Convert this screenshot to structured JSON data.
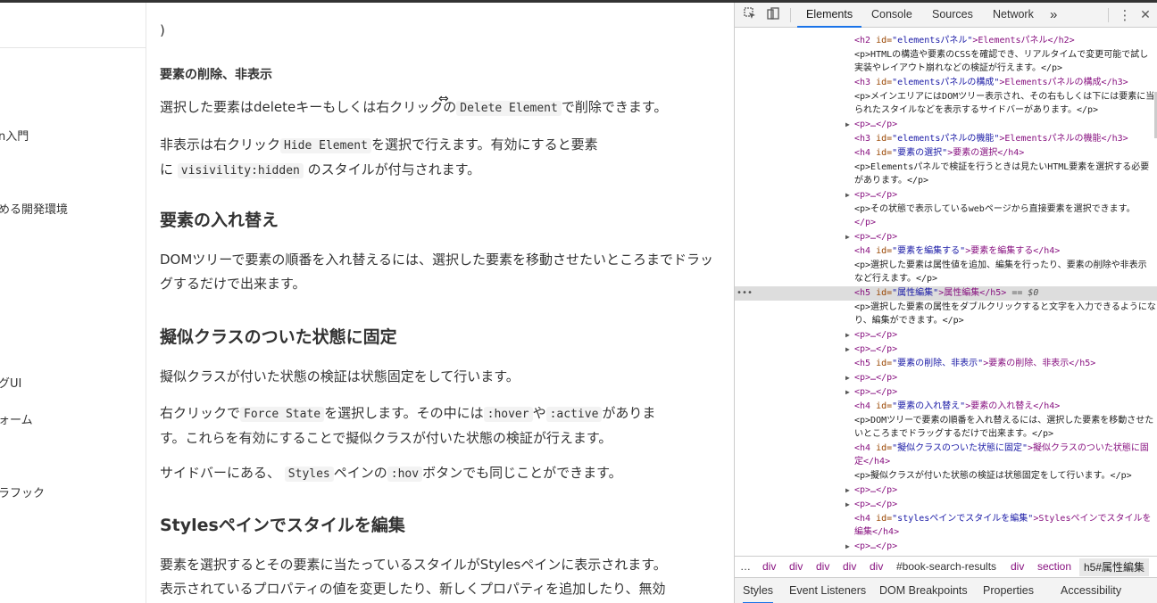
{
  "left_nav": {
    "items": [
      "n入門",
      "める開発環境",
      "グUI",
      "ォーム",
      "ラフック"
    ]
  },
  "article": {
    "paren": ")",
    "h_delete": "要素の削除、非表示",
    "p_delete_1a": "選択した要素はdeleteキーもしくは右クリックの",
    "code_delete": "Delete Element",
    "p_delete_1b": "で削除できます。",
    "p_hide_a": "非表示は右クリック",
    "code_hide": "Hide Element",
    "p_hide_b": "を選択で行えます。有効にすると要素",
    "p_hide_c": "に",
    "code_visibility": "visivility:hidden",
    "p_hide_d": "のスタイルが付与されます。",
    "h_swap": "要素の入れ替え",
    "p_swap": "DOMツリーで要素の順番を入れ替えるには、選択した要素を移動させたいところまでドラッグするだけで出来ます。",
    "h_pseudo": "擬似クラスのついた状態に固定",
    "p_pseudo_1": "擬似クラスが付いた状態の検証は状態固定をして行います。",
    "p_pseudo_2a": "右クリックで",
    "code_force": "Force State",
    "p_pseudo_2b": "を選択します。その中には",
    "code_hover": ":hover",
    "p_pseudo_2c": "や",
    "code_active": ":active",
    "p_pseudo_2d": "がありま",
    "p_pseudo_2e": "す。これらを有効にすることで擬似クラスが付いた状態の検証が行えます。",
    "p_pseudo_3a": "サイドバーにある、",
    "code_styles": "Styles",
    "p_pseudo_3b": "ペインの",
    "code_hov": ":hov",
    "p_pseudo_3c": "ボタンでも同じことができます。",
    "h_styles": "Stylesペインでスタイルを編集",
    "p_styles_1": "要素を選択するとその要素に当たっているスタイルがStylesペインに表示されます。",
    "p_styles_2": "表示されているプロパティの値を変更したり、新しくプロパティを追加したり、無効"
  },
  "devtools": {
    "icons": [
      "inspect-icon",
      "device-toggle-icon",
      "more-tabs-icon",
      "kebab-menu-icon",
      "close-icon"
    ],
    "tabs": [
      "Elements",
      "Console",
      "Sources",
      "Network"
    ],
    "more_tabs": "»",
    "kebab": "⋮",
    "close": "✕",
    "tree": {
      "l0": "・・・・・・・・・・・・・・・・・・・・・・・・・・・・・",
      "h2_tag_open": "<h2",
      "h2_attr": "id=",
      "h2_val": "\"elementsパネル\"",
      "h2_text": ">Elementsパネル</h2>",
      "p1a": "<p>HTMLの構造や要素のCSSを確認でき、リアルタイムで変更可能で試し",
      "p1b": "実装やレイアウト崩れなどの検証が行えます。</p>",
      "h3a_open": "<h3",
      "h3a_attr": "id=",
      "h3a_val": "\"elementsパネルの構成\"",
      "h3a_text": ">Elementsパネルの構成</h3>",
      "p2a": "<p>メインエリアにはDOMツリー表示され、その右もしくは下には要素に当て",
      "p2b": "られたスタイルなどを表示するサイドバーがあります。</p>",
      "collapsed": "<p>…</p>",
      "h3b_val": "\"elementsパネルの機能\"",
      "h3b_text": ">Elementsパネルの機能</h3>",
      "h4a_val": "\"要素の選択\"",
      "h4a_text": ">要素の選択</h4>",
      "p3a": "<p>Elementsパネルで検証を行うときは見たいHTML要素を選択する必要",
      "p3b": "があります。</p>",
      "p4a": "<p>その状態で表示しているwebページから直接要素を選択できます。",
      "p4b": "</p>",
      "h4b_val": "\"要素を編集する\"",
      "h4b_text": ">要素を編集する</h4>",
      "p5a": "<p>選択した要素は属性値を追加、編集を行ったり、要素の削除や非表示",
      "p5b": "など行えます。</p>",
      "h5a_val": "\"属性編集\"",
      "h5a_text": ">属性編集</h5>",
      "h5a_eq": " == $0",
      "p6a": "<p>選択した要素の属性をダブルクリックすると文字を入力できるようにな",
      "p6b": "り、編集ができます。</p>",
      "h5b_val": "\"要素の削除、非表示\"",
      "h5b_text": ">要素の削除、非表示</h5>",
      "h4c_val": "\"要素の入れ替え\"",
      "h4c_text": ">要素の入れ替え</h4>",
      "p7a": "<p>DOMツリーで要素の順番を入れ替えるには、選択した要素を移動させた",
      "p7b": "いところまでドラッグするだけで出来ます。</p>",
      "h4d_val": "\"擬似クラスのついた状態に固定\"",
      "h4d_text": ">擬似クラスのついた状態に固",
      "h4d_text2": "定</h4>",
      "p8": "<p>擬似クラスが付いた状態の検証は状態固定をして行います。</p>",
      "h4e_val": "\"stylesペインでスタイルを編集\"",
      "h4e_text": ">Stylesペインでスタイルを",
      "h4e_text2": "編集</h4>",
      "h4_open": "<h4",
      "h5_open": "<h5",
      "h3_open": "<h3",
      "id_attr": "id=",
      "ellipsis_row": "•••"
    },
    "breadcrumb": [
      "…",
      "div",
      "div",
      "div",
      "div",
      "div",
      "#book-search-results",
      "div",
      "section",
      "h5#属性編集"
    ],
    "subtabs": [
      "Styles",
      "Event Listeners",
      "DOM Breakpoints",
      "Properties",
      "Accessibility"
    ]
  },
  "cursor": "⇔"
}
